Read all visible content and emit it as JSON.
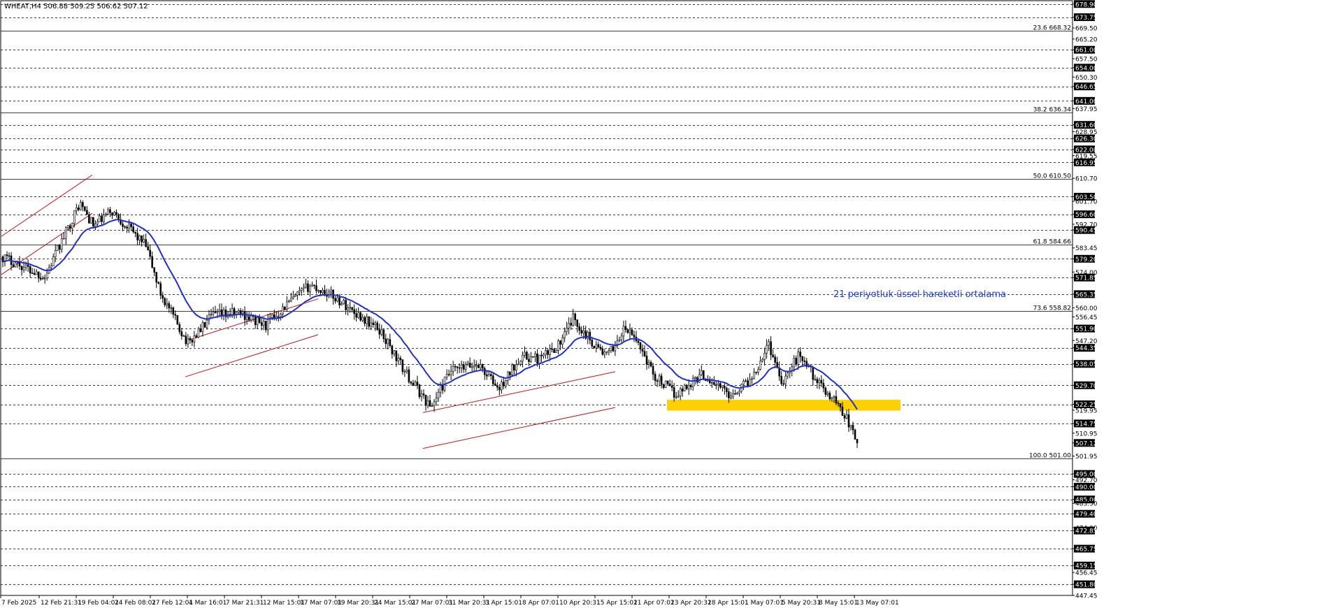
{
  "header": {
    "symbol_info": "WHEAT,H4  506.88 509.25 506.62 507.12"
  },
  "annotation": {
    "ema_label": "21 periyotluk üssel hareketli ortalama"
  },
  "colors": {
    "background": "#ffffff",
    "candle": "#000000",
    "ema": "#1f2fd0",
    "channel": "#d01010",
    "support_zone": "#ffd000",
    "grid": "#000000"
  },
  "chart_data": {
    "type": "candlestick",
    "instrument": "WHEAT",
    "timeframe": "H4",
    "ohlc_last": {
      "open": 506.88,
      "high": 509.25,
      "low": 506.62,
      "close": 507.12
    },
    "ylim": [
      447.45,
      680.2
    ],
    "x_labels": [
      "7 Feb 2025",
      "12 Feb 21:31",
      "19 Feb 04:01",
      "24 Feb 08:01",
      "27 Feb 12:01",
      "4 Mar 16:01",
      "7 Mar 21:31",
      "12 Mar 15:01",
      "17 Mar 07:01",
      "19 Mar 20:31",
      "24 Mar 15:01",
      "27 Mar 07:01",
      "31 Mar 20:31",
      "3 Apr 15:01",
      "8 Apr 07:01",
      "10 Apr 20:31",
      "15 Apr 15:01",
      "21 Apr 07:01",
      "23 Apr 20:31",
      "28 Apr 15:01",
      "1 May 07:01",
      "5 May 20:31",
      "8 May 15:01",
      "13 May 07:01"
    ],
    "y_ticks": [
      678.9,
      673.75,
      669.5,
      665.2,
      661.0,
      657.5,
      654.0,
      650.3,
      646.65,
      641.0,
      637.95,
      631.6,
      628.95,
      626.3,
      622.0,
      619.55,
      616.95,
      610.7,
      603.5,
      601.7,
      596.6,
      592.7,
      590.45,
      583.45,
      579.2,
      574.0,
      571.85,
      565.35,
      560.0,
      556.45,
      551.9,
      547.2,
      544.35,
      538.05,
      529.7,
      522.25,
      519.95,
      514.75,
      510.95,
      507.12,
      501.95,
      495.0,
      492.7,
      490.0,
      485.0,
      483.5,
      479.4,
      474.0,
      472.85,
      465.75,
      459.15,
      456.45,
      451.8,
      447.45
    ],
    "highlighted_levels": [
      678.9,
      673.75,
      661.0,
      654.0,
      646.65,
      641.0,
      631.6,
      626.3,
      622.0,
      616.95,
      603.5,
      596.6,
      590.45,
      579.2,
      571.85,
      565.35,
      551.9,
      544.35,
      538.05,
      529.7,
      522.25,
      514.75,
      507.12,
      495.0,
      490.0,
      485.0,
      479.4,
      472.85,
      465.75,
      459.15,
      451.8
    ],
    "horizontal_levels": [
      678.9,
      673.75,
      661.0,
      654.0,
      646.65,
      641.0,
      631.6,
      626.3,
      622.0,
      616.95,
      603.5,
      596.6,
      590.45,
      579.2,
      571.85,
      565.35,
      551.9,
      544.35,
      538.05,
      529.7,
      522.25,
      514.75,
      495.0,
      490.0,
      485.0,
      479.4,
      472.85,
      465.75,
      459.15,
      451.8
    ],
    "fibonacci": [
      {
        "label": "23.6 668.32",
        "price": 668.32
      },
      {
        "label": "38.2 636.34",
        "price": 636.34
      },
      {
        "label": "50.0 610.50",
        "price": 610.5
      },
      {
        "label": "61.8 584.66",
        "price": 584.66
      },
      {
        "label": "73.6 558.82",
        "price": 558.82
      },
      {
        "label": "100.0 501.00",
        "price": 501.0
      }
    ],
    "support_zone": {
      "from": 519.8,
      "to": 524.0
    },
    "ema_period": 21,
    "anchors": [
      {
        "t": 0,
        "p": 580
      },
      {
        "t": 60,
        "p": 572
      },
      {
        "t": 110,
        "p": 601
      },
      {
        "t": 130,
        "p": 592
      },
      {
        "t": 155,
        "p": 598
      },
      {
        "t": 185,
        "p": 590
      },
      {
        "t": 205,
        "p": 584
      },
      {
        "t": 225,
        "p": 566
      },
      {
        "t": 265,
        "p": 546
      },
      {
        "t": 300,
        "p": 557
      },
      {
        "t": 340,
        "p": 558
      },
      {
        "t": 375,
        "p": 553
      },
      {
        "t": 405,
        "p": 561
      },
      {
        "t": 440,
        "p": 569
      },
      {
        "t": 470,
        "p": 565
      },
      {
        "t": 500,
        "p": 559
      },
      {
        "t": 540,
        "p": 551
      },
      {
        "t": 575,
        "p": 535
      },
      {
        "t": 612,
        "p": 521
      },
      {
        "t": 640,
        "p": 535
      },
      {
        "t": 680,
        "p": 538
      },
      {
        "t": 710,
        "p": 528
      },
      {
        "t": 740,
        "p": 541
      },
      {
        "t": 770,
        "p": 540
      },
      {
        "t": 800,
        "p": 547
      },
      {
        "t": 815,
        "p": 556
      },
      {
        "t": 845,
        "p": 546
      },
      {
        "t": 865,
        "p": 541
      },
      {
        "t": 890,
        "p": 552
      },
      {
        "t": 910,
        "p": 546
      },
      {
        "t": 930,
        "p": 534
      },
      {
        "t": 962,
        "p": 526
      },
      {
        "t": 1000,
        "p": 534
      },
      {
        "t": 1040,
        "p": 526
      },
      {
        "t": 1070,
        "p": 532
      },
      {
        "t": 1095,
        "p": 546
      },
      {
        "t": 1115,
        "p": 531
      },
      {
        "t": 1140,
        "p": 542
      },
      {
        "t": 1170,
        "p": 529
      },
      {
        "t": 1190,
        "p": 524
      },
      {
        "t": 1205,
        "p": 518
      },
      {
        "t": 1222,
        "p": 507
      }
    ],
    "channels": [
      {
        "start": [
          2,
          588.0
        ],
        "end": [
          132,
          612.0
        ],
        "offset": 15
      },
      {
        "start": [
          265,
          547.0
        ],
        "end": [
          455,
          563.5
        ],
        "offset": 14
      },
      {
        "start": [
          605,
          519.0
        ],
        "end": [
          880,
          535.0
        ],
        "offset": 14
      }
    ]
  }
}
